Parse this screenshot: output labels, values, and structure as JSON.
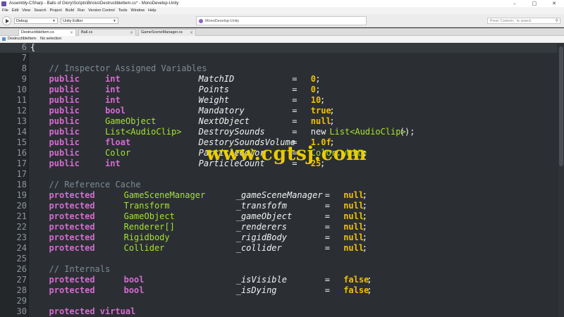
{
  "window": {
    "title": "Assembly-CSharp - Balls of Glory\\Scripts\\Bricks\\DestructibleItem.cs* - MonoDevelop-Unity",
    "minimize": "–",
    "maximize": "□",
    "close": "✕"
  },
  "menu": [
    "File",
    "Edit",
    "View",
    "Search",
    "Project",
    "Build",
    "Run",
    "Version Control",
    "Tools",
    "Window",
    "Help"
  ],
  "toolbar": {
    "config": "Debug",
    "target": "Unity Editor",
    "status": "MonoDevelop-Unity",
    "search_placeholder": "Press 'Control+,' to search"
  },
  "tabs": [
    {
      "label": "DestructibleItem.cs",
      "active": true
    },
    {
      "label": "Ball.cs",
      "active": false
    },
    {
      "label": "GameSceneManager.cs",
      "active": false
    }
  ],
  "breadcrumb": {
    "file": "DestructibleItem",
    "separator": "›",
    "selection": "No selection"
  },
  "code_lines": [
    {
      "n": "6",
      "tokens": [
        {
          "t": "{",
          "c": "pl",
          "col": 0
        }
      ]
    },
    {
      "n": "7",
      "tokens": []
    },
    {
      "n": "8",
      "tokens": [
        {
          "t": "// Inspector Assigned Variables",
          "c": "cm",
          "col": 4
        }
      ]
    },
    {
      "n": "9",
      "tokens": [
        {
          "t": "public",
          "c": "kw",
          "col": 4
        },
        {
          "t": "int",
          "c": "kw",
          "col": 16
        },
        {
          "t": "MatchID",
          "c": "id",
          "col": 36
        },
        {
          "t": "=",
          "c": "op",
          "col": 56
        },
        {
          "t": "0",
          "c": "lit",
          "col": 60
        },
        {
          "t": ";",
          "c": "pl",
          "col": 61
        }
      ]
    },
    {
      "n": "10",
      "tokens": [
        {
          "t": "public",
          "c": "kw",
          "col": 4
        },
        {
          "t": "int",
          "c": "kw",
          "col": 16
        },
        {
          "t": "Points",
          "c": "id",
          "col": 36
        },
        {
          "t": "=",
          "c": "op",
          "col": 56
        },
        {
          "t": "0",
          "c": "lit",
          "col": 60
        },
        {
          "t": ";",
          "c": "pl",
          "col": 61
        }
      ]
    },
    {
      "n": "11",
      "tokens": [
        {
          "t": "public",
          "c": "kw",
          "col": 4
        },
        {
          "t": "int",
          "c": "kw",
          "col": 16
        },
        {
          "t": "Weight",
          "c": "id",
          "col": 36
        },
        {
          "t": "=",
          "c": "op",
          "col": 56
        },
        {
          "t": "10",
          "c": "lit",
          "col": 60
        },
        {
          "t": ";",
          "c": "pl",
          "col": 62
        }
      ]
    },
    {
      "n": "12",
      "tokens": [
        {
          "t": "public",
          "c": "kw",
          "col": 4
        },
        {
          "t": "bool",
          "c": "kw",
          "col": 16
        },
        {
          "t": "Mandatory",
          "c": "id",
          "col": 36
        },
        {
          "t": "=",
          "c": "op",
          "col": 56
        },
        {
          "t": "true",
          "c": "lit",
          "col": 60
        },
        {
          "t": ";",
          "c": "pl",
          "col": 64
        }
      ]
    },
    {
      "n": "13",
      "tokens": [
        {
          "t": "public",
          "c": "kw",
          "col": 4
        },
        {
          "t": "GameObject",
          "c": "ty",
          "col": 16
        },
        {
          "t": "NextObject",
          "c": "id",
          "col": 36
        },
        {
          "t": "=",
          "c": "op",
          "col": 56
        },
        {
          "t": "null",
          "c": "lit",
          "col": 60
        },
        {
          "t": ";",
          "c": "pl",
          "col": 64
        }
      ]
    },
    {
      "n": "14",
      "tokens": [
        {
          "t": "public",
          "c": "kw",
          "col": 4
        },
        {
          "t": "List<AudioClip>",
          "c": "ty",
          "col": 16
        },
        {
          "t": "DestroySounds",
          "c": "id",
          "col": 36
        },
        {
          "t": "=",
          "c": "op",
          "col": 56
        },
        {
          "t": "new",
          "c": "pl",
          "col": 60
        },
        {
          "t": "List<AudioClip>",
          "c": "ty",
          "col": 64
        },
        {
          "t": "();",
          "c": "pl",
          "col": 79
        }
      ]
    },
    {
      "n": "15",
      "tokens": [
        {
          "t": "public",
          "c": "kw",
          "col": 4
        },
        {
          "t": "float",
          "c": "kw",
          "col": 16
        },
        {
          "t": "DestorySoundsVolume",
          "c": "id",
          "col": 36
        },
        {
          "t": "=",
          "c": "op",
          "col": 56
        },
        {
          "t": "1.0f",
          "c": "lit",
          "col": 60
        },
        {
          "t": ";",
          "c": "pl",
          "col": 64
        }
      ]
    },
    {
      "n": "16",
      "tokens": [
        {
          "t": "public",
          "c": "kw",
          "col": 4
        },
        {
          "t": "Color",
          "c": "ty",
          "col": 16
        },
        {
          "t": "ParticleColor",
          "c": "id",
          "col": 36
        },
        {
          "t": "=",
          "c": "op",
          "col": 56
        },
        {
          "t": "Color.white",
          "c": "ty",
          "col": 60
        },
        {
          "t": ";",
          "c": "pl",
          "col": 71
        }
      ]
    },
    {
      "n": "17",
      "tokens": [
        {
          "t": "public",
          "c": "kw",
          "col": 4
        },
        {
          "t": "int",
          "c": "kw",
          "col": 16
        },
        {
          "t": "ParticleCount",
          "c": "id",
          "col": 36
        },
        {
          "t": "=",
          "c": "op",
          "col": 56
        },
        {
          "t": "25",
          "c": "lit",
          "col": 60
        },
        {
          "t": ";",
          "c": "pl",
          "col": 62
        }
      ]
    },
    {
      "n": "17",
      "tokens": []
    },
    {
      "n": "18",
      "tokens": [
        {
          "t": "// Reference Cache",
          "c": "cm",
          "col": 4
        }
      ]
    },
    {
      "n": "19",
      "tokens": [
        {
          "t": "protected",
          "c": "kw",
          "col": 4
        },
        {
          "t": "GameSceneManager",
          "c": "ty",
          "col": 20
        },
        {
          "t": "_gameSceneManager",
          "c": "id",
          "col": 44
        },
        {
          "t": "=",
          "c": "op",
          "col": 63
        },
        {
          "t": "null",
          "c": "lit",
          "col": 67
        },
        {
          "t": ";",
          "c": "pl",
          "col": 71
        }
      ]
    },
    {
      "n": "20",
      "tokens": [
        {
          "t": "protected",
          "c": "kw",
          "col": 4
        },
        {
          "t": "Transform",
          "c": "ty",
          "col": 20
        },
        {
          "t": "_transfofm",
          "c": "id",
          "col": 44
        },
        {
          "t": "=",
          "c": "op",
          "col": 63
        },
        {
          "t": "null",
          "c": "lit",
          "col": 67
        },
        {
          "t": ";",
          "c": "pl",
          "col": 71
        }
      ]
    },
    {
      "n": "21",
      "tokens": [
        {
          "t": "protected",
          "c": "kw",
          "col": 4
        },
        {
          "t": "GameObject",
          "c": "ty",
          "col": 20
        },
        {
          "t": "_gameObject",
          "c": "id",
          "col": 44
        },
        {
          "t": "=",
          "c": "op",
          "col": 63
        },
        {
          "t": "null",
          "c": "lit",
          "col": 67
        },
        {
          "t": ";",
          "c": "pl",
          "col": 71
        }
      ]
    },
    {
      "n": "22",
      "tokens": [
        {
          "t": "protected",
          "c": "kw",
          "col": 4
        },
        {
          "t": "Renderer[]",
          "c": "ty",
          "col": 20
        },
        {
          "t": "_renderers",
          "c": "id",
          "col": 44
        },
        {
          "t": "=",
          "c": "op",
          "col": 63
        },
        {
          "t": "null",
          "c": "lit",
          "col": 67
        },
        {
          "t": ";",
          "c": "pl",
          "col": 71
        }
      ]
    },
    {
      "n": "23",
      "tokens": [
        {
          "t": "protected",
          "c": "kw",
          "col": 4
        },
        {
          "t": "Rigidbody",
          "c": "ty",
          "col": 20
        },
        {
          "t": "_rigidBody",
          "c": "id",
          "col": 44
        },
        {
          "t": "=",
          "c": "op",
          "col": 63
        },
        {
          "t": "null",
          "c": "lit",
          "col": 67
        },
        {
          "t": ";",
          "c": "pl",
          "col": 71
        }
      ]
    },
    {
      "n": "24",
      "tokens": [
        {
          "t": "protected",
          "c": "kw",
          "col": 4
        },
        {
          "t": "Collider",
          "c": "ty",
          "col": 20
        },
        {
          "t": "_collider",
          "c": "id",
          "col": 44
        },
        {
          "t": "=",
          "c": "op",
          "col": 63
        },
        {
          "t": "null",
          "c": "lit",
          "col": 67
        },
        {
          "t": ";",
          "c": "pl",
          "col": 71
        }
      ]
    },
    {
      "n": "25",
      "tokens": []
    },
    {
      "n": "26",
      "tokens": [
        {
          "t": "// Internals",
          "c": "cm",
          "col": 4
        }
      ]
    },
    {
      "n": "27",
      "tokens": [
        {
          "t": "protected",
          "c": "kw",
          "col": 4
        },
        {
          "t": "bool",
          "c": "kw",
          "col": 20
        },
        {
          "t": "_isVisible",
          "c": "id",
          "col": 44
        },
        {
          "t": "=",
          "c": "op",
          "col": 63
        },
        {
          "t": "false",
          "c": "lit",
          "col": 67
        },
        {
          "t": ";",
          "c": "pl",
          "col": 72
        }
      ]
    },
    {
      "n": "28",
      "tokens": [
        {
          "t": "protected",
          "c": "kw",
          "col": 4
        },
        {
          "t": "bool",
          "c": "kw",
          "col": 20
        },
        {
          "t": "_isDying",
          "c": "id",
          "col": 44
        },
        {
          "t": "=",
          "c": "op",
          "col": 63
        },
        {
          "t": "false",
          "c": "lit",
          "col": 67
        },
        {
          "t": ";",
          "c": "pl",
          "col": 72
        }
      ]
    },
    {
      "n": "29",
      "tokens": []
    },
    {
      "n": "30",
      "tokens": [
        {
          "t": "protected virtual",
          "c": "kw",
          "col": 4
        }
      ]
    },
    {
      "n": "31",
      "tokens": []
    }
  ],
  "watermark": "www.cgtsj.com",
  "colors": {
    "editor_bg": "#2b2f33",
    "keyword": "#d66bd2",
    "type": "#a6e22e",
    "literal": "#f0c000",
    "comment": "#7e8a94"
  }
}
